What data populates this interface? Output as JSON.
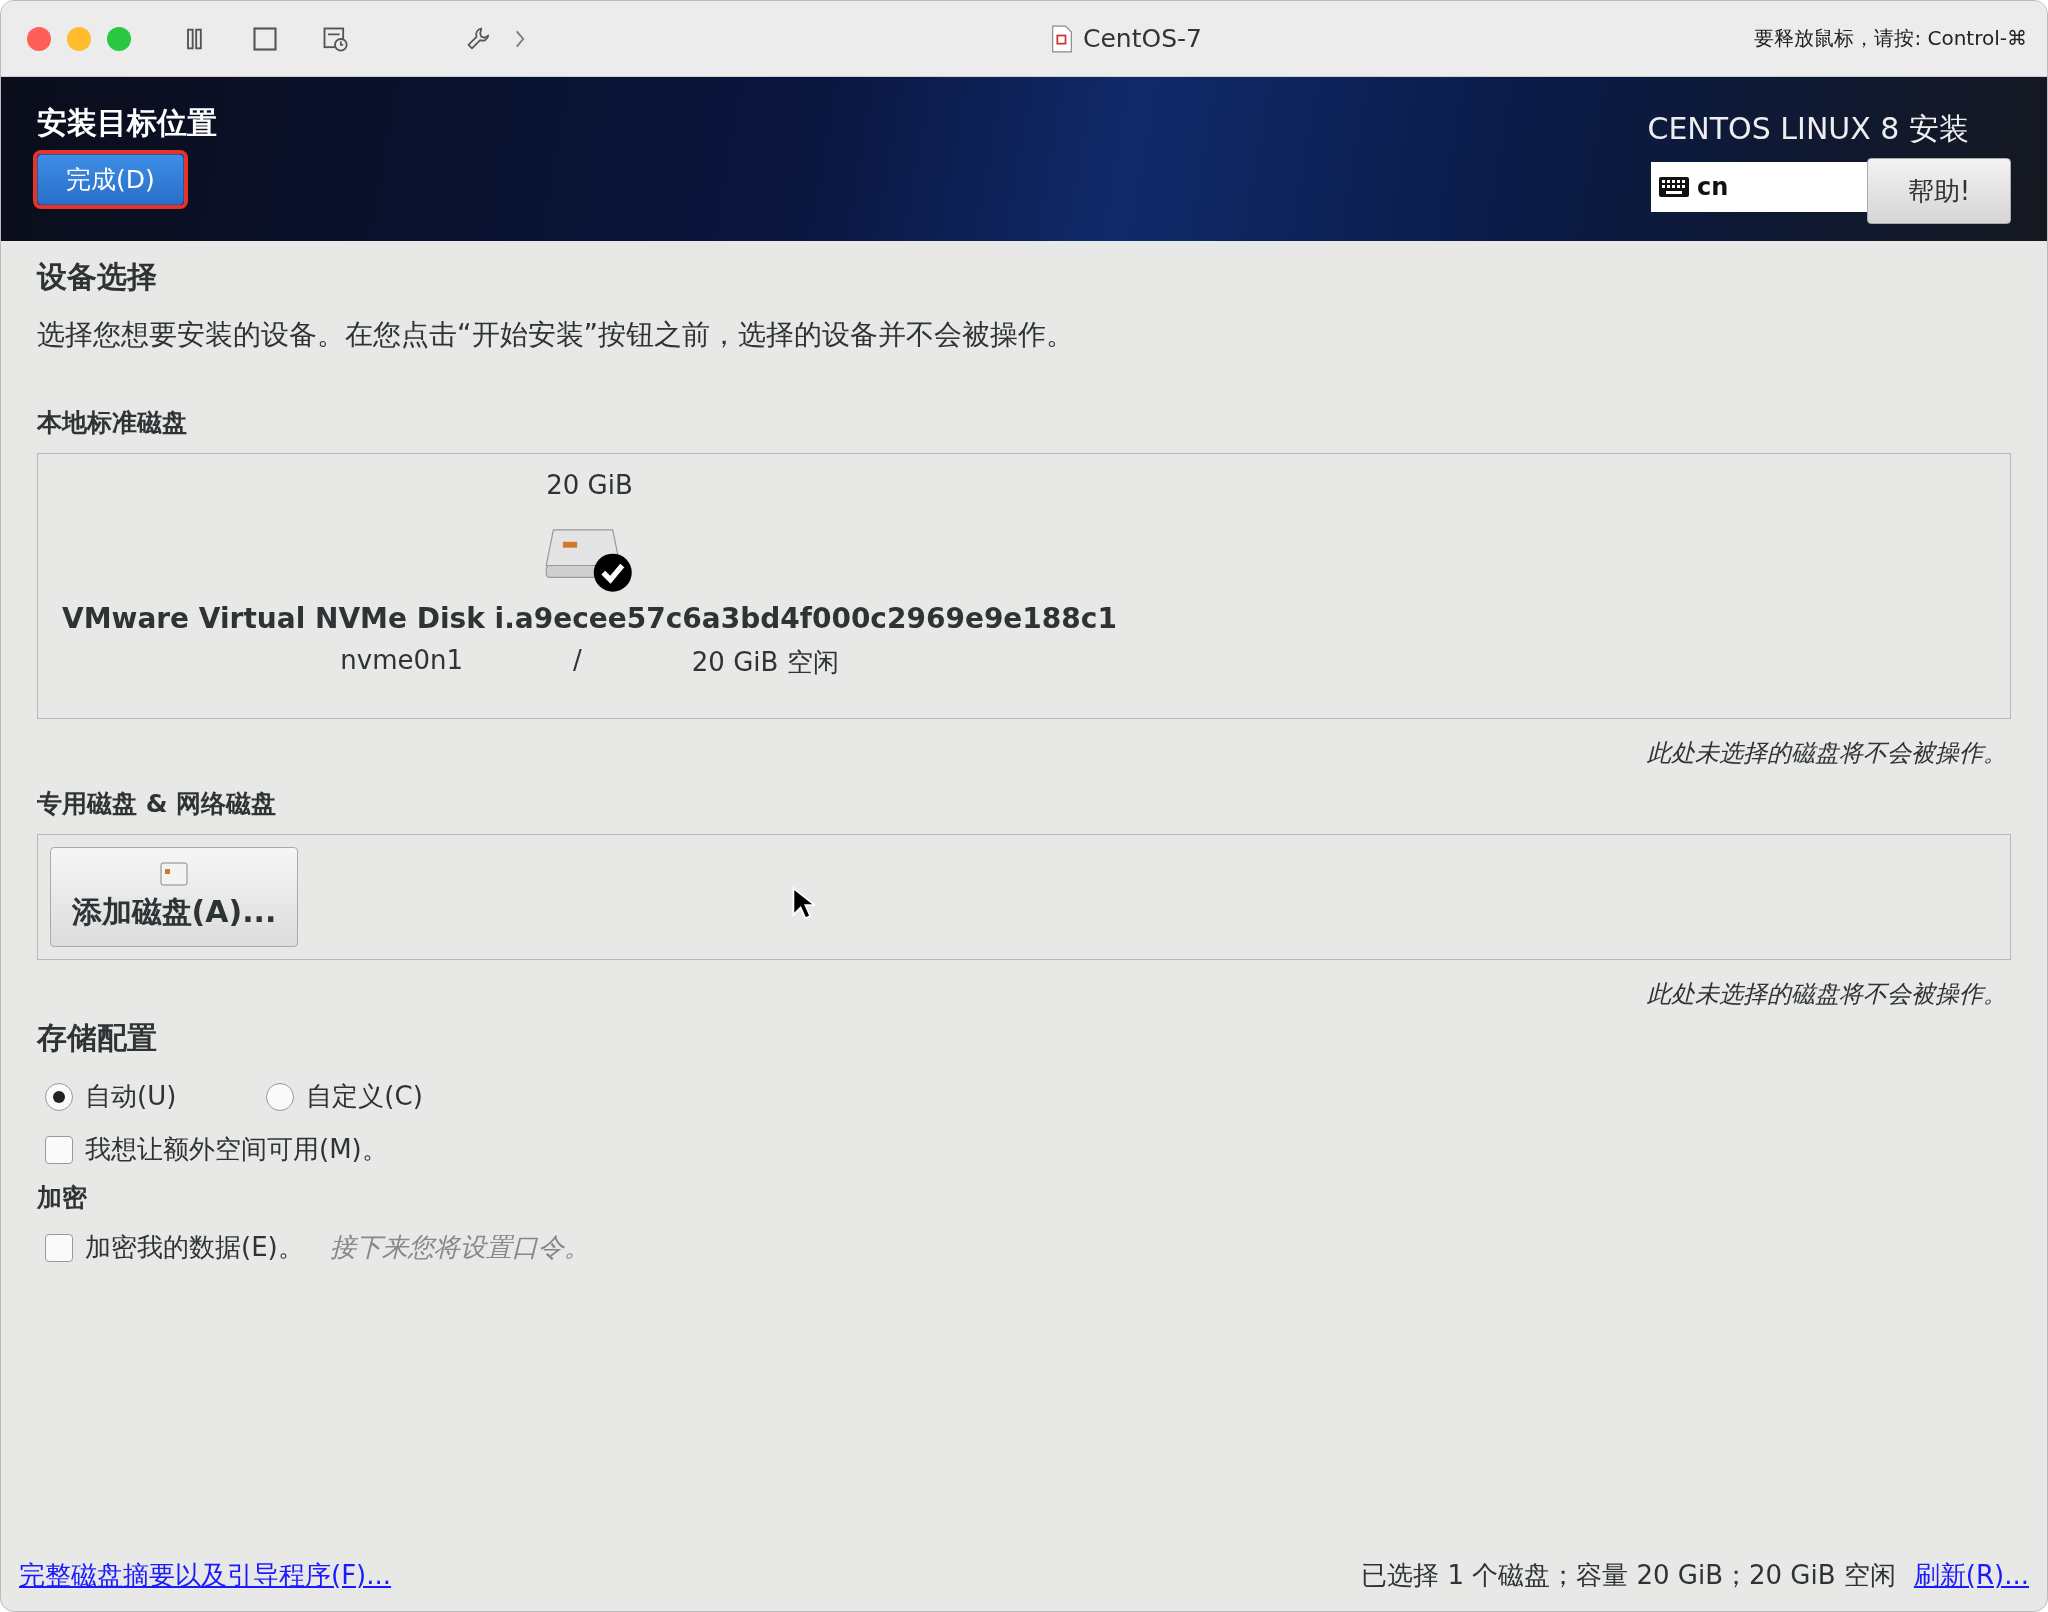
{
  "window": {
    "title": "CentOS-7",
    "hint": "要释放鼠标，请按: Control-⌘"
  },
  "header": {
    "title": "安装目标位置",
    "done_button": {
      "label": "完成(D)",
      "focused": true
    },
    "product": "CENTOS LINUX 8 安装",
    "keyboard_layout": "cn",
    "help_button": "帮助!"
  },
  "device_selection": {
    "heading": "设备选择",
    "description": "选择您想要安装的设备。在您点击“开始安装”按钮之前，选择的设备并不会被操作。"
  },
  "local_disks": {
    "heading": "本地标准磁盘",
    "disks": [
      {
        "size": "20 GiB",
        "name": "VMware Virtual NVMe Disk i.a9ecee57c6a3bd4f000c2969e9e188c1",
        "device": "nvme0n1",
        "separator": "/",
        "free": "20 GiB 空闲",
        "selected": true
      }
    ],
    "note": "此处未选择的磁盘将不会被操作。"
  },
  "network_disks": {
    "heading": "专用磁盘 & 网络磁盘",
    "add_button": "添加磁盘(A)...",
    "note": "此处未选择的磁盘将不会被操作。"
  },
  "storage_config": {
    "heading": "存储配置",
    "options": [
      {
        "label": "自动(U)",
        "selected": true
      },
      {
        "label": "自定义(C)",
        "selected": false
      }
    ],
    "extra_space": {
      "label": "我想让额外空间可用(M)。",
      "checked": false
    }
  },
  "encryption": {
    "heading": "加密",
    "encrypt": {
      "label": "加密我的数据(E)。",
      "checked": false
    },
    "hint": "接下来您将设置口令。"
  },
  "footer": {
    "summary_link": "完整磁盘摘要以及引导程序(F)...",
    "status": "已选择 1 个磁盘；容量 20 GiB；20 GiB 空闲",
    "refresh_link": "刷新(R)..."
  }
}
